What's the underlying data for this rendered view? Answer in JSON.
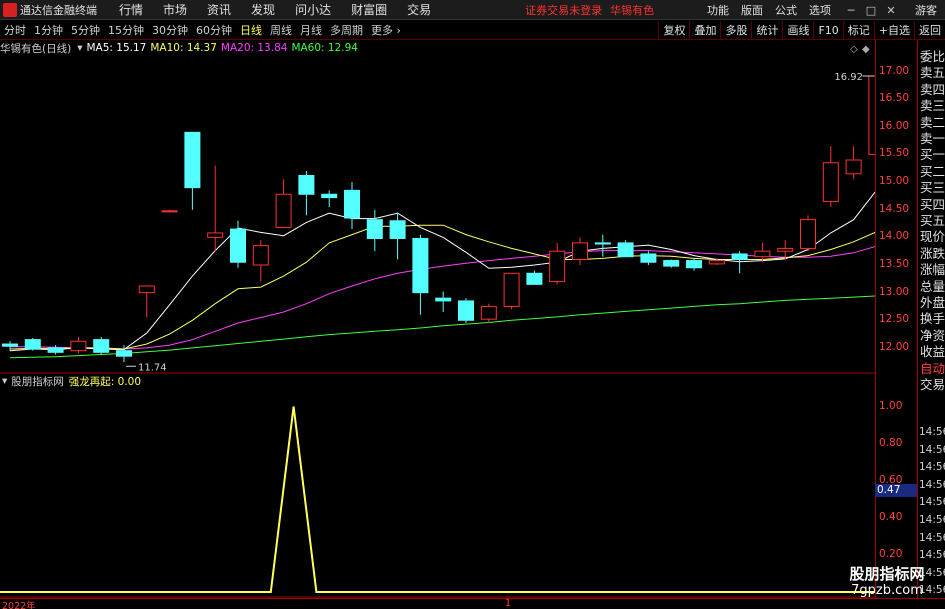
{
  "menubar": {
    "app_title": "通达信金融终端",
    "menus": [
      "行情",
      "市场",
      "资讯",
      "发现",
      "问小达",
      "财富圈",
      "交易"
    ],
    "login_status": "证券交易未登录",
    "stock_name": "华锡有色",
    "right_menus": [
      "功能",
      "版面",
      "公式",
      "选项"
    ],
    "guest": "游客"
  },
  "periods": [
    "分时",
    "1分钟",
    "5分钟",
    "15分钟",
    "30分钟",
    "60分钟",
    "日线",
    "周线",
    "月线",
    "多周期",
    "更多"
  ],
  "active_period": "日线",
  "tools": [
    "复权",
    "叠加",
    "多股",
    "统计",
    "画线",
    "F10",
    "标记",
    "+自选",
    "返回"
  ],
  "chart_title": "华锡有色(日线)",
  "ma": [
    {
      "label": "MA5: 15.17",
      "color": "#ffffff"
    },
    {
      "label": "MA10: 14.37",
      "color": "#ffff60"
    },
    {
      "label": "MA20: 13.84",
      "color": "#ff40ff"
    },
    {
      "label": "MA60: 12.94",
      "color": "#40ff40"
    }
  ],
  "indicator": {
    "source": "股朋指标网",
    "name": "强龙再起: 0.00",
    "source_color": "#d0d0d0",
    "name_color": "#ffff60"
  },
  "annotations": {
    "high": "16.92",
    "low": "11.74"
  },
  "y_ticks": [
    "17.00",
    "16.50",
    "16.00",
    "15.50",
    "15.00",
    "14.50",
    "14.00",
    "13.50",
    "13.00",
    "12.50",
    "12.00"
  ],
  "ind_ticks": [
    "1.00",
    "0.80",
    "0.60",
    "0.40",
    "0.20"
  ],
  "current_value": "0.47",
  "side_panel": [
    "委比",
    "卖五",
    "卖四",
    "卖三",
    "卖二",
    "卖一",
    "买一",
    "买二",
    "买三",
    "买四",
    "买五",
    "现价",
    "涨跌",
    "涨幅",
    "总量",
    "外盘",
    "换手",
    "净资",
    "收益",
    "自动",
    "交易"
  ],
  "side_times": [
    "14:56",
    "14:56",
    "14:56",
    "14:56",
    "14:56",
    "14:56",
    "14:56",
    "14:56",
    "14:56",
    "14:56"
  ],
  "bottom": {
    "year": "2022年",
    "mid": "1"
  },
  "watermark": {
    "cn": "股朋指标网",
    "url": "7gpzb.com"
  },
  "colors": {
    "up": "#ff3030",
    "down": "#54ffff",
    "ma5": "#ffffff",
    "ma10": "#ffff60",
    "ma20": "#ff40ff",
    "ma60": "#40ff40",
    "indicator": "#ffff60"
  },
  "chart_data": {
    "type": "candlestick",
    "ylim": [
      11.6,
      17.3
    ],
    "candles": [
      {
        "o": 12.07,
        "h": 12.12,
        "l": 11.95,
        "c": 12.03
      },
      {
        "o": 12.15,
        "h": 12.18,
        "l": 11.95,
        "c": 11.98
      },
      {
        "o": 12.0,
        "h": 12.05,
        "l": 11.88,
        "c": 11.92
      },
      {
        "o": 11.95,
        "h": 12.2,
        "l": 11.9,
        "c": 12.12
      },
      {
        "o": 12.15,
        "h": 12.2,
        "l": 11.88,
        "c": 11.92
      },
      {
        "o": 11.95,
        "h": 12.05,
        "l": 11.74,
        "c": 11.85
      },
      {
        "o": 13.0,
        "h": 13.12,
        "l": 12.55,
        "c": 13.12
      },
      {
        "o": 14.48,
        "h": 14.5,
        "l": 14.45,
        "c": 14.48
      },
      {
        "o": 15.9,
        "h": 15.9,
        "l": 14.5,
        "c": 14.9
      },
      {
        "o": 14.0,
        "h": 15.3,
        "l": 13.75,
        "c": 14.08
      },
      {
        "o": 14.15,
        "h": 14.3,
        "l": 13.45,
        "c": 13.55
      },
      {
        "o": 13.5,
        "h": 13.95,
        "l": 13.2,
        "c": 13.85
      },
      {
        "o": 14.18,
        "h": 15.05,
        "l": 14.18,
        "c": 14.78
      },
      {
        "o": 15.12,
        "h": 15.2,
        "l": 14.4,
        "c": 14.78
      },
      {
        "o": 14.78,
        "h": 14.85,
        "l": 14.55,
        "c": 14.72
      },
      {
        "o": 14.85,
        "h": 15.0,
        "l": 14.15,
        "c": 14.35
      },
      {
        "o": 14.32,
        "h": 14.5,
        "l": 13.75,
        "c": 13.98
      },
      {
        "o": 14.3,
        "h": 14.45,
        "l": 13.6,
        "c": 13.98
      },
      {
        "o": 13.98,
        "h": 14.05,
        "l": 12.6,
        "c": 13.0
      },
      {
        "o": 12.9,
        "h": 13.02,
        "l": 12.65,
        "c": 12.85
      },
      {
        "o": 12.85,
        "h": 12.9,
        "l": 12.45,
        "c": 12.5
      },
      {
        "o": 12.52,
        "h": 12.8,
        "l": 12.45,
        "c": 12.75
      },
      {
        "o": 12.75,
        "h": 13.35,
        "l": 12.7,
        "c": 13.35
      },
      {
        "o": 13.35,
        "h": 13.4,
        "l": 13.15,
        "c": 13.15
      },
      {
        "o": 13.2,
        "h": 13.9,
        "l": 13.15,
        "c": 13.75
      },
      {
        "o": 13.6,
        "h": 14.0,
        "l": 13.5,
        "c": 13.9
      },
      {
        "o": 13.9,
        "h": 14.05,
        "l": 13.65,
        "c": 13.88
      },
      {
        "o": 13.9,
        "h": 13.95,
        "l": 13.65,
        "c": 13.65
      },
      {
        "o": 13.7,
        "h": 13.75,
        "l": 13.5,
        "c": 13.55
      },
      {
        "o": 13.58,
        "h": 13.6,
        "l": 13.45,
        "c": 13.48
      },
      {
        "o": 13.58,
        "h": 13.62,
        "l": 13.4,
        "c": 13.45
      },
      {
        "o": 13.52,
        "h": 13.62,
        "l": 13.5,
        "c": 13.58
      },
      {
        "o": 13.7,
        "h": 13.75,
        "l": 13.35,
        "c": 13.6
      },
      {
        "o": 13.65,
        "h": 13.9,
        "l": 13.55,
        "c": 13.75
      },
      {
        "o": 13.75,
        "h": 13.95,
        "l": 13.6,
        "c": 13.8
      },
      {
        "o": 13.8,
        "h": 14.4,
        "l": 13.75,
        "c": 14.32
      },
      {
        "o": 14.65,
        "h": 15.65,
        "l": 14.55,
        "c": 15.35
      },
      {
        "o": 15.15,
        "h": 15.65,
        "l": 15.05,
        "c": 15.4
      },
      {
        "o": 15.5,
        "h": 16.92,
        "l": 15.35,
        "c": 16.92
      }
    ],
    "ma5": [
      11.95,
      11.98,
      11.97,
      12.0,
      11.98,
      11.97,
      12.27,
      12.78,
      13.3,
      13.76,
      14.17,
      14.09,
      14.03,
      14.27,
      14.44,
      14.34,
      14.34,
      14.44,
      14.18,
      14.0,
      13.73,
      13.44,
      13.46,
      13.5,
      13.55,
      13.75,
      13.8,
      13.83,
      13.86,
      13.78,
      13.67,
      13.6,
      13.56,
      13.58,
      13.61,
      13.78,
      14.08,
      14.32,
      14.85
    ],
    "ma10": [
      11.98,
      11.99,
      11.99,
      12.0,
      12.0,
      11.98,
      12.07,
      12.25,
      12.5,
      12.8,
      13.07,
      13.1,
      13.3,
      13.55,
      13.9,
      14.05,
      14.2,
      14.2,
      14.22,
      14.22,
      14.05,
      13.92,
      13.8,
      13.7,
      13.6,
      13.6,
      13.62,
      13.66,
      13.67,
      13.66,
      13.62,
      13.6,
      13.6,
      13.6,
      13.63,
      13.67,
      13.78,
      13.92,
      14.1
    ],
    "ma20": [
      12.02,
      12.02,
      12.01,
      12.0,
      12.0,
      11.98,
      12.0,
      12.05,
      12.15,
      12.3,
      12.45,
      12.55,
      12.65,
      12.8,
      12.98,
      13.12,
      13.25,
      13.35,
      13.42,
      13.48,
      13.53,
      13.58,
      13.62,
      13.66,
      13.7,
      13.74,
      13.76,
      13.76,
      13.76,
      13.74,
      13.72,
      13.7,
      13.68,
      13.66,
      13.64,
      13.64,
      13.66,
      13.72,
      13.84
    ],
    "ma60": [
      11.82,
      11.83,
      11.84,
      11.86,
      11.88,
      11.9,
      11.93,
      11.96,
      12.0,
      12.04,
      12.08,
      12.12,
      12.16,
      12.2,
      12.24,
      12.27,
      12.3,
      12.33,
      12.36,
      12.4,
      12.43,
      12.46,
      12.5,
      12.53,
      12.56,
      12.6,
      12.63,
      12.66,
      12.69,
      12.72,
      12.75,
      12.78,
      12.8,
      12.83,
      12.86,
      12.88,
      12.9,
      12.92,
      12.94
    ],
    "indicator_values": [
      0,
      0,
      0,
      0,
      0,
      0,
      0,
      0,
      0,
      0,
      0,
      0,
      1,
      0,
      0,
      0,
      0,
      0,
      0,
      0,
      0,
      0,
      0,
      0,
      0,
      0,
      0,
      0,
      0,
      0,
      0,
      0,
      0,
      0,
      0,
      0,
      0,
      0,
      0
    ],
    "indicator_ylim": [
      0,
      1.1
    ]
  }
}
